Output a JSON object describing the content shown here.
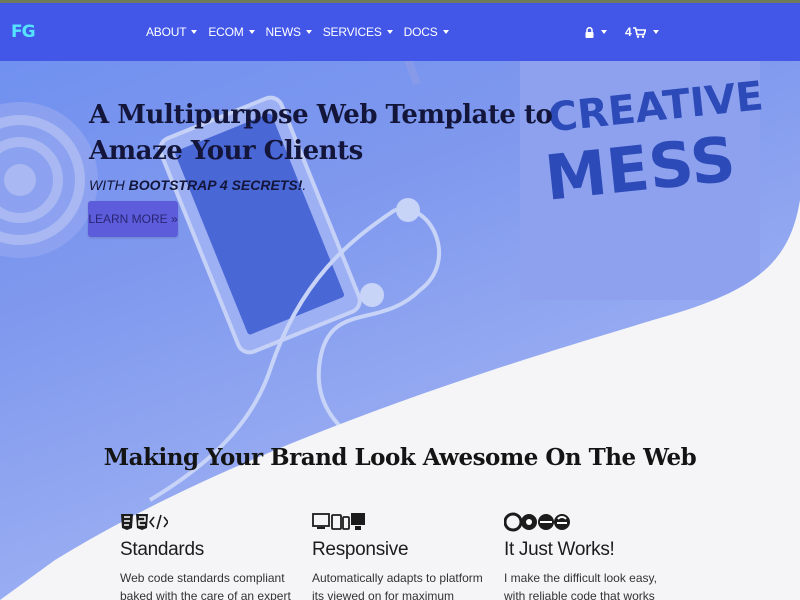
{
  "nav": {
    "brand": "FG",
    "links": [
      {
        "label": "ABOUT"
      },
      {
        "label": "ECOM"
      },
      {
        "label": "NEWS"
      },
      {
        "label": "SERVICES"
      },
      {
        "label": "DOCS"
      }
    ],
    "cart_count": "4",
    "icons": {
      "lock": "lock-icon",
      "cart": "cart-icon"
    }
  },
  "hero": {
    "title": "A Multipurpose Web Template to Amaze Your Clients",
    "subtitle_prefix": "WITH ",
    "subtitle_strong": "BOOTSTRAP 4 SECRETS!",
    "subtitle_suffix": ".",
    "button": "LEARN MORE »",
    "poster_line1": "CREATIVE",
    "poster_line2": "MESS"
  },
  "features_title": "Making Your Brand Look Awesome On The Web",
  "features": [
    {
      "icon": "web-standards-icons",
      "title": "Standards",
      "text": "Web code standards compliant baked with the care of an expert chef that"
    },
    {
      "icon": "devices-icon",
      "title": "Responsive",
      "text": "Automatically adapts to platform its viewed on for maximum visual user"
    },
    {
      "icon": "browsers-icon",
      "title": "It Just Works!",
      "text": "I make the difficult look easy, with reliable code that works every time in"
    }
  ],
  "colors": {
    "nav": "#4257e8",
    "accent": "#5d5cdb",
    "brand": "#55e4ff",
    "hero": "#7f98ee"
  }
}
